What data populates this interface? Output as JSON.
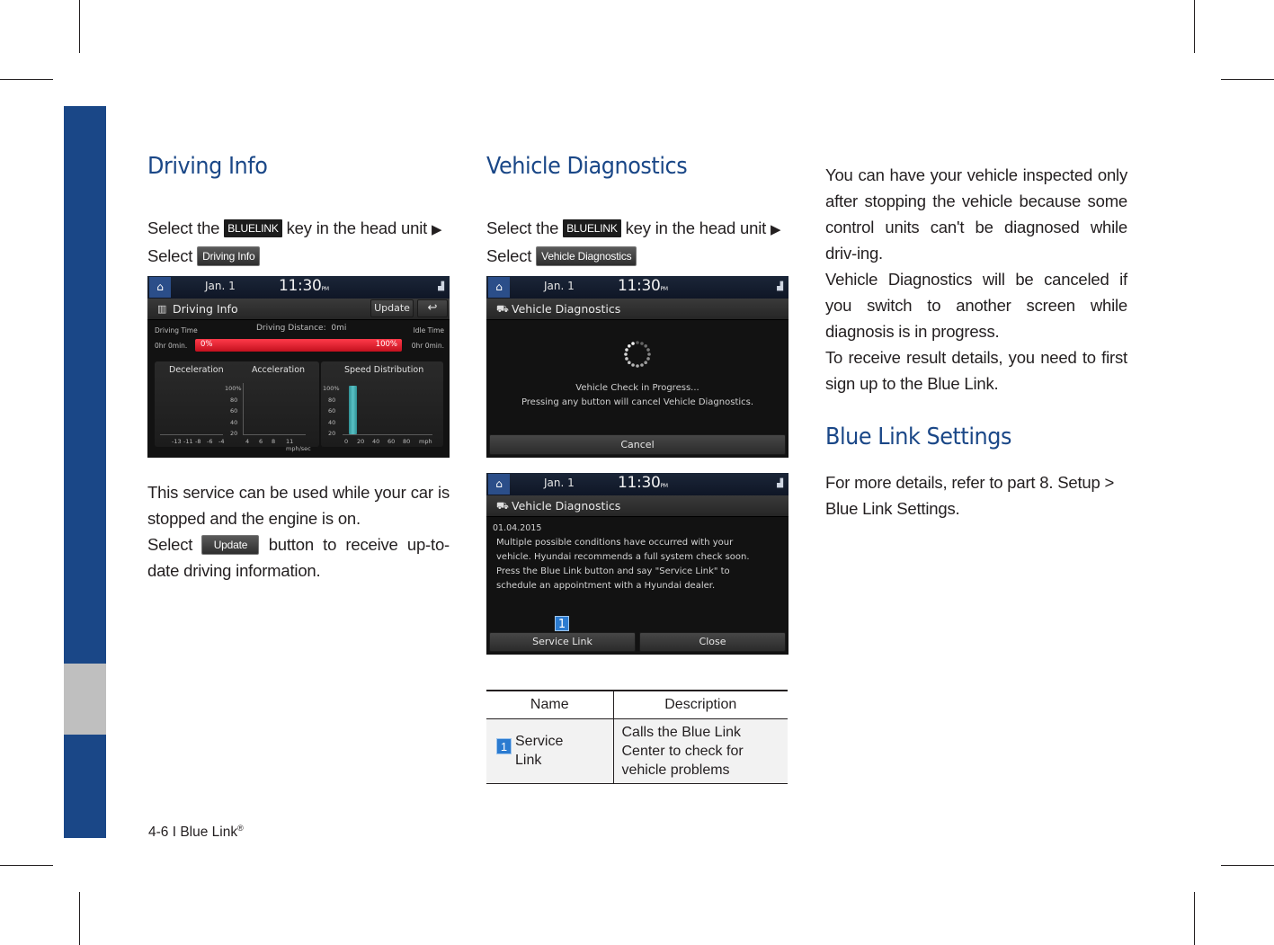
{
  "footer": {
    "page": "4-6 I Blue Link",
    "reg": "®"
  },
  "driving_info": {
    "title": "Driving Info",
    "instr_prefix": "Select the",
    "key_label": "BLUELINK",
    "instr_mid": "key in the head unit",
    "arrow": "▶",
    "instr_select": "Select",
    "menu_button": "Driving Info",
    "para1": "This service can be used while your car is stopped and the engine is on.",
    "para2_prefix": "Select",
    "update_button": "Update",
    "para2_suffix": "button to receive up-to-date driving information.",
    "screen": {
      "date": "Jan.   1",
      "time": "11:30",
      "ampm": "PM",
      "title": "Driving Info",
      "update": "Update",
      "back_icon": "↩",
      "driving_time_label": "Driving Time",
      "driving_time_value": "0hr 0min.",
      "distance_label": "Driving Distance:",
      "distance_value": "0mi",
      "idle_time_label": "Idle Time",
      "idle_time_value": "0hr 0min.",
      "ratio_left": "0%",
      "ratio_right": "100%",
      "driving_ratio_percent": 100,
      "decel_title": "Deceleration",
      "accel_title": "Acceleration",
      "speed_title": "Speed Distribution",
      "y_ticks": [
        "100%",
        "80",
        "60",
        "40",
        "20"
      ],
      "decel_x_ticks": [
        "-13",
        "-11",
        "-8",
        "-6",
        "-4"
      ],
      "accel_x_ticks": [
        "4",
        "6",
        "8",
        "11 mph/sec"
      ],
      "speed_x_ticks": [
        "0",
        "20",
        "40",
        "60",
        "80",
        "mph"
      ],
      "speed_bar_0_20_percent": 100
    }
  },
  "vehicle_diagnostics": {
    "title": "Vehicle Diagnostics",
    "instr_prefix": "Select the",
    "key_label": "BLUELINK",
    "instr_mid": "key in the head unit",
    "arrow": "▶",
    "instr_select": "Select",
    "menu_button": "Vehicle Diagnostics",
    "screen1": {
      "date": "Jan.   1",
      "time": "11:30",
      "ampm": "PM",
      "title": "Vehicle Diagnostics",
      "msg1": "Vehicle Check in Progress...",
      "msg2": "Pressing any button will cancel Vehicle Diagnostics.",
      "cancel": "Cancel"
    },
    "screen2": {
      "date": "Jan.   1",
      "time": "11:30",
      "ampm": "PM",
      "title": "Vehicle Diagnostics",
      "report_date": "01.04.2015",
      "line1": "Multiple possible conditions have occurred with your",
      "line2": "vehicle.  Hyundai recommends a full system check soon.",
      "line3": "Press the Blue Link button and say \"Service Link\" to",
      "line4": "schedule an appointment with a Hyundai dealer.",
      "callout": "1",
      "service_link": "Service Link",
      "close": "Close"
    },
    "table": {
      "headers": [
        "Name",
        "Description"
      ],
      "rows": [
        {
          "num": "1",
          "name_line1": "Service",
          "name_line2": "Link",
          "desc_line1": "Calls the Blue Link",
          "desc_line2": "Center to check for",
          "desc_line3": "vehicle problems"
        }
      ]
    }
  },
  "right_col": {
    "para1": "You can have your vehicle inspected only after stopping the vehicle because some control units can't be diagnosed while driv-ing.",
    "para2": "Vehicle Diagnostics will be canceled if you switch to another screen while diagnosis is in progress.",
    "para3": "To receive result details, you need to first sign up to the Blue Link.",
    "settings_title": "Blue Link Settings",
    "settings_text": "For more details, refer to part 8. Setup > Blue Link Settings."
  },
  "colors": {
    "brand_blue": "#1a4787",
    "tab_grey": "#bfbfbf",
    "callout_blue": "#2b7bd0",
    "ratio_red": "#e3192b",
    "bar_teal": "#3fa9ad"
  }
}
